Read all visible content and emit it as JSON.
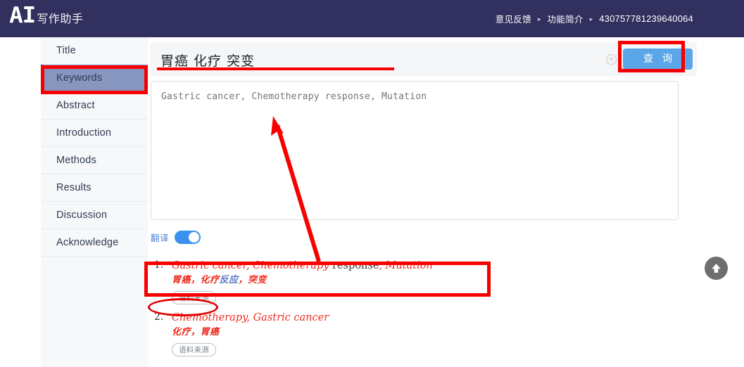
{
  "header": {
    "logo_main": "AI",
    "logo_sub": "写作助手",
    "nav": [
      {
        "label": "意见反馈",
        "icon": "chevron-right-icon"
      },
      {
        "label": "功能简介",
        "icon": "chevron-right-icon"
      }
    ],
    "separator": "▸",
    "user_id": "430757781239640064",
    "background_color": "#31305e"
  },
  "sidebar": {
    "items": [
      {
        "label": "Title",
        "selected": false
      },
      {
        "label": "Keywords",
        "selected": true
      },
      {
        "label": "Abstract",
        "selected": false
      },
      {
        "label": "Introduction",
        "selected": false
      },
      {
        "label": "Methods",
        "selected": false
      },
      {
        "label": "Results",
        "selected": false
      },
      {
        "label": "Discussion",
        "selected": false
      },
      {
        "label": "Acknowledge",
        "selected": false
      }
    ],
    "selected_color": "#8796bf",
    "background_color": "#f7f8fa"
  },
  "search": {
    "value": "胃癌 化疗 突变",
    "clear_icon": "×",
    "button_label": "查 询",
    "button_color": "#5aa6e8"
  },
  "editor": {
    "placeholder": "Gastric cancer, Chemotherapy response, Mutation",
    "value": "Gastric cancer, Chemotherapy response, Mutation"
  },
  "translate_toggle": {
    "label": "翻译",
    "state": "on",
    "color": "#3c91f0"
  },
  "results": [
    {
      "number": "1.",
      "en_parts": [
        {
          "text": "Gastric cancer",
          "highlight": true
        },
        {
          "text": ", ",
          "highlight": true
        },
        {
          "text": "Chemotherapy",
          "highlight": true
        },
        {
          "text": " response",
          "highlight": false
        },
        {
          "text": ", ",
          "highlight": true
        },
        {
          "text": "Mutation",
          "highlight": true
        }
      ],
      "zh_parts": [
        {
          "text": "胃癌，化疗",
          "highlight": true
        },
        {
          "text": "反应",
          "highlight": false
        },
        {
          "text": "，突变",
          "highlight": true
        }
      ],
      "source_button": "语料来源"
    },
    {
      "number": "2.",
      "en_parts": [
        {
          "text": "Chemotherapy",
          "highlight": true
        },
        {
          "text": ", ",
          "highlight": true
        },
        {
          "text": "Gastric cancer",
          "highlight": true
        }
      ],
      "zh_parts": [
        {
          "text": "化疗，胃癌",
          "highlight": true
        }
      ],
      "source_button": "语料来源"
    }
  ],
  "scroll_top_button": {
    "icon": "arrow-up-icon",
    "color": "#6e6e6e"
  },
  "annotations": {
    "color": "#f90000",
    "sidebar_box": "Keywords menu item highlighted",
    "search_underline": "search query underlined",
    "query_button_box": "query button highlighted",
    "result_box": "first result highlighted",
    "source_ellipse": "corpus source button circled",
    "arrow": "from first result to keywords textarea"
  }
}
